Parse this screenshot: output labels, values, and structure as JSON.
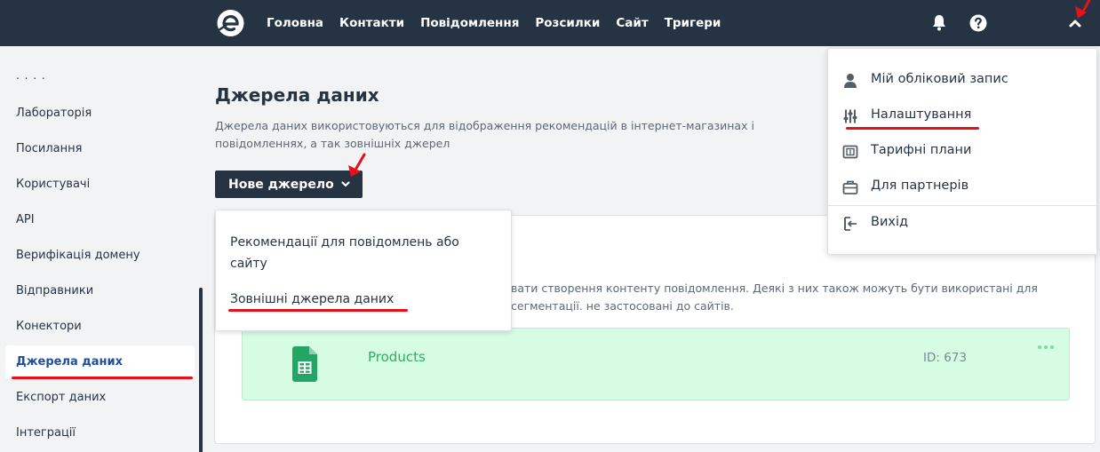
{
  "topbar": {
    "nav": [
      "Головна",
      "Контакти",
      "Повідомлення",
      "Розсилки",
      "Сайт",
      "Тригери"
    ],
    "icons": [
      "bell-icon",
      "help-icon",
      "chevron-up-icon"
    ]
  },
  "sidebar": {
    "cut_off_text": ". . . .",
    "items": [
      {
        "label": "Лабораторія"
      },
      {
        "label": "Посилання"
      },
      {
        "label": "Користувачі"
      },
      {
        "label": "API"
      },
      {
        "label": "Верифікація домену"
      },
      {
        "label": "Відправники"
      },
      {
        "label": "Конектори"
      },
      {
        "label": "Джерела даних",
        "active": true
      },
      {
        "label": "Експорт даних"
      },
      {
        "label": "Інтеграції"
      }
    ]
  },
  "main": {
    "title": "Джерела даних",
    "description": "Джерела даних використовуються для відображення рекомендацій в інтернет-магазинах і повідомленнях, а так зовнішніх джерел",
    "new_source_button": "Нове джерело",
    "card_description": "вати створення контенту повідомлення. Деякі з них також можуть бути використані для сегментації. не застосовані до сайтів.",
    "source": {
      "name": "Products",
      "id_text": "ID: 673",
      "icon": "google-sheets-icon"
    }
  },
  "new_source_dropdown": {
    "items": [
      "Рекомендації для повідомлень або сайту",
      "Зовнішні джерела даних"
    ]
  },
  "user_menu": {
    "items": [
      {
        "label": "Мій обліковий запис",
        "icon": "user-icon"
      },
      {
        "label": "Налаштування",
        "icon": "settings-sliders-icon"
      },
      {
        "label": "Тарифні плани",
        "icon": "pricing-icon"
      },
      {
        "label": "Для партнерів",
        "icon": "briefcase-icon"
      },
      {
        "label": "Вихід",
        "icon": "logout-icon"
      }
    ]
  },
  "colors": {
    "topbar": "#253342",
    "accent": "#1e4f9c",
    "source_bg": "#d6fce3",
    "source_text": "#2fae5e",
    "annotation": "#e8101a"
  }
}
